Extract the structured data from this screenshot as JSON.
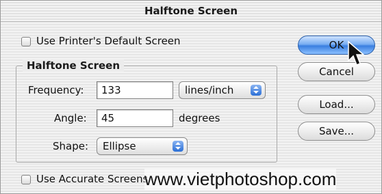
{
  "window": {
    "title": "Halftone Screen"
  },
  "options": {
    "use_printer_default_label": "Use Printer's Default Screen",
    "use_accurate_label": "Use Accurate Screens"
  },
  "group": {
    "legend": "Halftone Screen",
    "frequency": {
      "label": "Frequency:",
      "value": "133",
      "unit": "lines/inch"
    },
    "angle": {
      "label": "Angle:",
      "value": "45",
      "unit": "degrees"
    },
    "shape": {
      "label": "Shape:",
      "value": "Ellipse"
    }
  },
  "buttons": {
    "ok": "OK",
    "cancel": "Cancel",
    "load": "Load...",
    "save": "Save..."
  },
  "watermark": "www.vietphotoshop.com",
  "colors": {
    "default_button": "#3a7fe0",
    "popup_arrow": "#2b6fd6"
  },
  "icons": {
    "cursor": "arrow-cursor-icon",
    "popup": "updown-arrow-icon"
  }
}
